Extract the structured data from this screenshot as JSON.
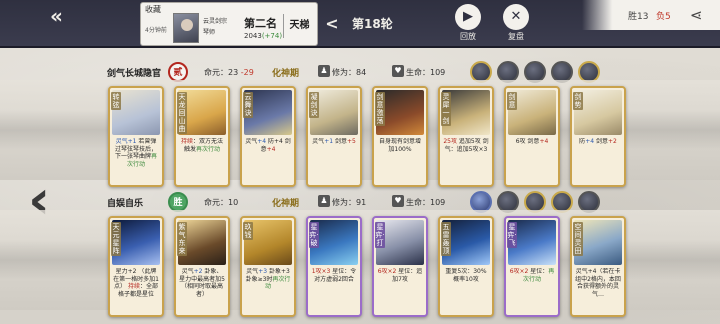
{
  "topbar": {
    "back_icon": "double-arrow-left-icon",
    "collect_label": "收藏",
    "time": "4分钟前",
    "player_name": "云灵剑宗",
    "player_sub": "琴师",
    "rank_title": "第二名",
    "score": "2043",
    "score_delta": "(+74)",
    "ladder_label": "天梯",
    "round_label": "第18轮",
    "replay_label": "回放",
    "review_label": "复盘",
    "win_label": "胜13",
    "lose_label": "负5"
  },
  "player1": {
    "name": "剑气长城隐官",
    "seal": "贰",
    "mingyuan_label": "命元：",
    "mingyuan_value": "23",
    "mingyuan_delta": "-29",
    "realm": "化神期",
    "xiuwei": "修为：84",
    "hp": "生命：109",
    "cards": [
      {
        "name": "转弦",
        "border": "gold",
        "desc": [
          {
            "t": "灵气+1",
            "c": "hb"
          },
          {
            "t": " 若曾弹过琴弦琴技后，下一张琴曲牌",
            "c": ""
          },
          {
            "t": "再次行动",
            "c": "hl"
          }
        ]
      },
      {
        "name": "天龙回山曲",
        "border": "gold",
        "desc": [
          {
            "t": "持续",
            "c": "hr"
          },
          {
            "t": "：双方无法触发",
            "c": ""
          },
          {
            "t": "再次行动",
            "c": "hl"
          }
        ]
      },
      {
        "name": "云舞诀",
        "border": "gold",
        "desc": [
          {
            "t": "灵气",
            "c": ""
          },
          {
            "t": "+4",
            "c": "hb"
          },
          {
            "t": " 防+4 剑意",
            "c": ""
          },
          {
            "t": "+4",
            "c": "hr"
          }
        ]
      },
      {
        "name": "凝剑诀",
        "border": "gold",
        "desc": [
          {
            "t": "灵气",
            "c": ""
          },
          {
            "t": "+1",
            "c": "hb"
          },
          {
            "t": " 剑意",
            "c": ""
          },
          {
            "t": "+5",
            "c": "hr"
          }
        ]
      },
      {
        "name": "剑意激荡",
        "border": "gold",
        "desc": [
          {
            "t": "自身现有剑意增加100%",
            "c": ""
          }
        ]
      },
      {
        "name": "灵犀一剑",
        "border": "gold",
        "desc": [
          {
            "t": "25攻",
            "c": "hr"
          },
          {
            "t": " 追加5攻 剑气：追加5攻×3",
            "c": ""
          }
        ]
      },
      {
        "name": "剑意",
        "border": "gold",
        "desc": [
          {
            "t": "6攻 剑意",
            "c": ""
          },
          {
            "t": "+4",
            "c": "hr"
          }
        ]
      },
      {
        "name": "剑势",
        "border": "gold",
        "desc": [
          {
            "t": "防",
            "c": ""
          },
          {
            "t": "+4",
            "c": "hb"
          },
          {
            "t": " 剑意",
            "c": ""
          },
          {
            "t": "+2",
            "c": "hr"
          }
        ]
      }
    ]
  },
  "player2": {
    "name": "自娱自乐",
    "seal": "胜",
    "mingyuan_label": "命元：",
    "mingyuan_value": "10",
    "realm": "化神期",
    "xiuwei": "修为：91",
    "hp": "生命：109",
    "cards": [
      {
        "name": "天元星阵",
        "border": "gold",
        "desc": [
          {
            "t": "星力+2 （此牌在第一格时多加1点） ",
            "c": ""
          },
          {
            "t": "持续",
            "c": "hr"
          },
          {
            "t": "：全部格子都是星位",
            "c": ""
          }
        ]
      },
      {
        "name": "紫气东来",
        "border": "gold",
        "desc": [
          {
            "t": "灵气",
            "c": ""
          },
          {
            "t": "+2",
            "c": "hb"
          },
          {
            "t": " 卦象、星力中最高者加5（相同时取最高者）",
            "c": ""
          }
        ]
      },
      {
        "name": "玖钱",
        "border": "gold",
        "desc": [
          {
            "t": "灵气",
            "c": ""
          },
          {
            "t": "+3",
            "c": "hb"
          },
          {
            "t": " 卦象+3 卦象≥3时",
            "c": ""
          },
          {
            "t": "再次行动",
            "c": "hl"
          }
        ]
      },
      {
        "name": "星弈·破",
        "border": "purple",
        "desc": [
          {
            "t": "1攻×3",
            "c": "hr"
          },
          {
            "t": " 星位：令对方虚弱2回合",
            "c": ""
          }
        ]
      },
      {
        "name": "星弈·打",
        "border": "purple",
        "desc": [
          {
            "t": "6攻×2",
            "c": "hr"
          },
          {
            "t": " 星位：追加7攻",
            "c": ""
          }
        ]
      },
      {
        "name": "五雷轰顶",
        "border": "gold",
        "desc": [
          {
            "t": "重复5次：30%概率10攻",
            "c": ""
          }
        ]
      },
      {
        "name": "星弈·飞",
        "border": "purple",
        "desc": [
          {
            "t": "6攻×2",
            "c": "hr"
          },
          {
            "t": " 星位：",
            "c": ""
          },
          {
            "t": "再次行动",
            "c": "hl"
          }
        ]
      },
      {
        "name": "空间灵田",
        "border": "gold",
        "desc": [
          {
            "t": "灵气+4（若在卡组中2格内，本回合获得额外的灵气…",
            "c": ""
          }
        ]
      }
    ]
  },
  "colors": {
    "topbar": "#2f3040",
    "gold": "#c9a24c",
    "purple": "#9b6cc9",
    "red": "#b3261e",
    "green": "#3d8a3d"
  }
}
